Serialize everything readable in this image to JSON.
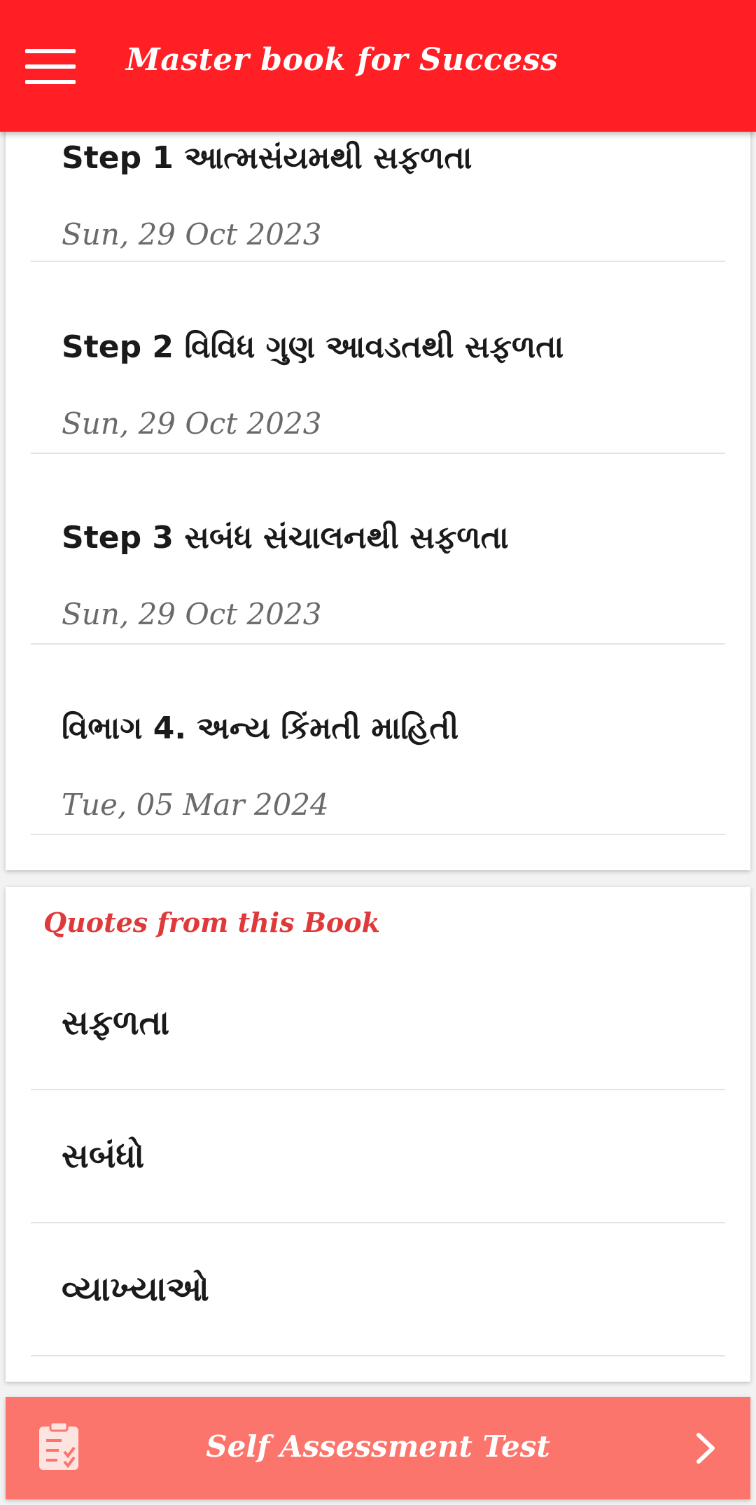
{
  "app_bar": {
    "title": "Master book for Success"
  },
  "chapters": [
    {
      "title": "Step 1 આત્મસંયમથી સફળતા",
      "date": "Sun, 29 Oct 2023"
    },
    {
      "title": "Step 2 વિવિધ ગુણ આવડતથી સફળતા",
      "date": "Sun, 29 Oct 2023"
    },
    {
      "title": "Step 3 સબંધ સંચાલનથી સફળતા",
      "date": "Sun, 29 Oct 2023"
    },
    {
      "title": "વિભાગ 4. અન્ય કિંમતી માહિતી",
      "date": "Tue, 05 Mar 2024"
    }
  ],
  "quotes": {
    "heading": "Quotes from this Book",
    "items": [
      {
        "label": "સફળતા"
      },
      {
        "label": "સબંધો"
      },
      {
        "label": "વ્યાખ્યાઓ"
      }
    ]
  },
  "assessment": {
    "label": "Self Assessment Test",
    "icon": "clipboard-checklist-icon"
  },
  "colors": {
    "app_bar": "#ff1f24",
    "quotes_heading": "#e0393a",
    "assessment_bar": "#fb756c"
  }
}
